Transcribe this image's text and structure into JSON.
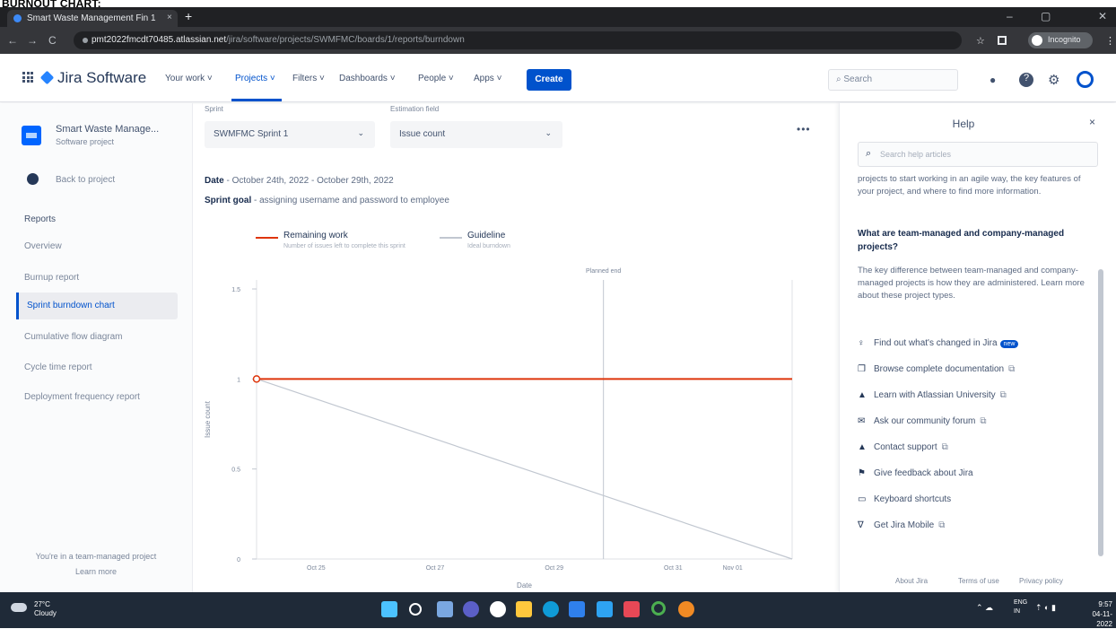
{
  "caption": "BURNOUT CHART:",
  "browser": {
    "tab_title": "Smart Waste Management Fin 1",
    "tab_close": "×",
    "new_tab": "+",
    "url_host": "pmt2022fmcdt70485.atlassian.net",
    "url_path": "/jira/software/projects/SWMFMC/boards/1/reports/burndown",
    "profile_label": "Incognito",
    "win_minimize": "–",
    "win_maximize": "▢",
    "win_close": "✕",
    "back": "←",
    "forward": "→",
    "reload": "C",
    "star": "☆",
    "menu": "⋮"
  },
  "jira": {
    "logo": "Jira Software",
    "nav": [
      "Your work ˅",
      "Projects ˅",
      "Filters ˅",
      "Dashboards ˅",
      "People ˅",
      "Apps ˅"
    ],
    "create": "Create",
    "search_placeholder": "Search",
    "icons": {
      "notification": "●",
      "help": "?",
      "settings": "⚙"
    }
  },
  "sidebar": {
    "project_name": "Smart Waste Manage...",
    "project_type": "Software project",
    "back": "Back to project",
    "section": "Reports",
    "items": [
      "Overview",
      "Burnup report",
      "Sprint burndown chart",
      "Cumulative flow diagram",
      "Cycle time report",
      "Deployment frequency report"
    ],
    "active_index": 2,
    "footer_line1": "You're in a team-managed project",
    "footer_line2": "Learn more"
  },
  "report": {
    "sprint_label": "Sprint",
    "sprint_value": "SWMFMC Sprint 1",
    "estimation_label": "Estimation field",
    "estimation_value": "Issue count",
    "more": "•••",
    "date_label": "Date",
    "date_value": " - October 24th, 2022 - October 29th, 2022",
    "goal_label": "Sprint goal",
    "goal_value": " - assigning username and password to employee",
    "legend": [
      {
        "name": "Remaining work",
        "sub": "Number of issues left to complete this sprint",
        "color": "#de350b"
      },
      {
        "name": "Guideline",
        "sub": "Ideal burndown",
        "color": "#c1c7d0"
      }
    ]
  },
  "chart_data": {
    "type": "line",
    "ylabel": "Issue count",
    "xlabel": "Date",
    "ylim": [
      0,
      1
    ],
    "yticks": [
      "0",
      "0.5",
      "1",
      "1.5"
    ],
    "xticks": [
      "Oct 25",
      "Oct 27",
      "Oct 29",
      "Oct 31",
      "Nov 01"
    ],
    "marker_label": "Planned end",
    "series": [
      {
        "name": "Remaining work",
        "color": "#de350b",
        "x": [
          "Oct 24",
          "Nov 02"
        ],
        "y": [
          1,
          1
        ]
      },
      {
        "name": "Guideline",
        "color": "#c1c7d0",
        "x": [
          "Oct 24",
          "Nov 02"
        ],
        "y": [
          1,
          0
        ]
      }
    ]
  },
  "help": {
    "title": "Help",
    "close": "×",
    "search_placeholder": "Search help articles",
    "intro": "projects to start working in an agile way, the key features of your project, and where to find more information.",
    "question": "What are team-managed and company-managed projects?",
    "answer": "The key difference between team-managed and company-managed projects is how they are administered. Learn more about these project types.",
    "links": [
      {
        "icon": "♀",
        "label": "Find out what's changed in Jira",
        "badge": "new",
        "ext": ""
      },
      {
        "icon": "❐",
        "label": "Browse complete documentation",
        "badge": "",
        "ext": "⧉"
      },
      {
        "icon": "▲",
        "label": "Learn with Atlassian University",
        "badge": "",
        "ext": "⧉"
      },
      {
        "icon": "✉",
        "label": "Ask our community forum",
        "badge": "",
        "ext": "⧉"
      },
      {
        "icon": "▲",
        "label": "Contact support",
        "badge": "",
        "ext": "⧉"
      },
      {
        "icon": "⚑",
        "label": "Give feedback about Jira",
        "badge": "",
        "ext": ""
      },
      {
        "icon": "▭",
        "label": "Keyboard shortcuts",
        "badge": "",
        "ext": ""
      },
      {
        "icon": "∇",
        "label": "Get Jira Mobile",
        "badge": "",
        "ext": "⧉"
      }
    ],
    "footer": [
      "About Jira",
      "Terms of use",
      "Privacy policy"
    ]
  },
  "taskbar": {
    "weather_temp": "27°C",
    "weather_desc": "Cloudy",
    "lang": "ENG",
    "lang2": "IN",
    "time": "9:57",
    "date": "04-11-2022",
    "tray_icons": "⌃ ☁",
    "tray_net": "⇡ ◐ ▮"
  }
}
